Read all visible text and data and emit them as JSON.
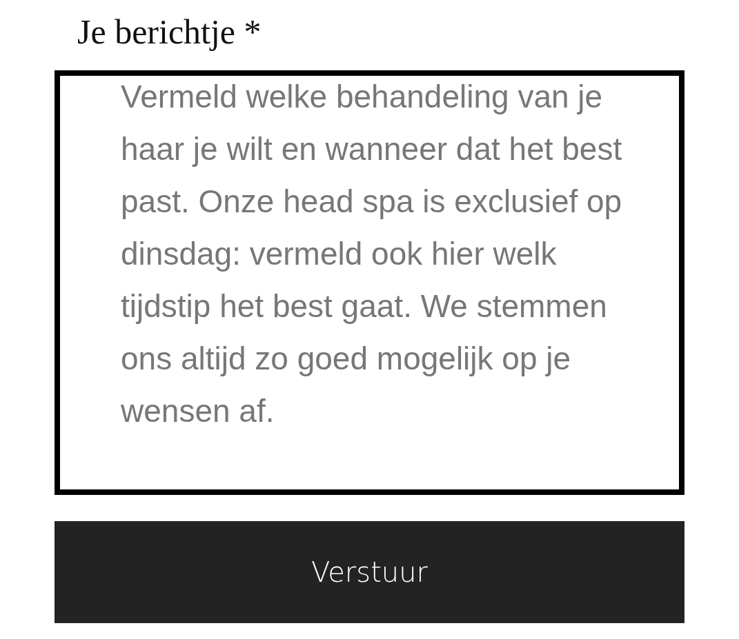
{
  "form": {
    "label": "Je berichtje *",
    "message": {
      "placeholder": "Vermeld welke behandeling van je haar je wilt en wanneer dat het best past. Onze head spa is exclusief op dinsdag: vermeld ook hier welk tijdstip het best gaat. We stemmen ons altijd zo goed mogelijk op je wensen af."
    },
    "submit": "Verstuur"
  }
}
